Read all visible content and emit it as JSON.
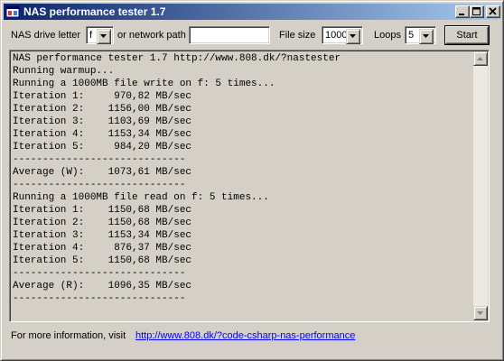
{
  "window": {
    "title": "NAS performance tester 1.7",
    "icon": "app-window-icon"
  },
  "toolbar": {
    "drive_label": "NAS drive letter",
    "drive_value": "f",
    "network_label": "or network path",
    "network_value": "",
    "filesize_label": "File size",
    "filesize_value": "1000",
    "loops_label": "Loops",
    "loops_value": "5",
    "start_label": "Start"
  },
  "output": {
    "lines": [
      "NAS performance tester 1.7 http://www.808.dk/?nastester",
      "Running warmup...",
      "Running a 1000MB file write on f: 5 times...",
      "Iteration 1:     970,82 MB/sec",
      "Iteration 2:    1156,00 MB/sec",
      "Iteration 3:    1103,69 MB/sec",
      "Iteration 4:    1153,34 MB/sec",
      "Iteration 5:     984,20 MB/sec",
      "-----------------------------",
      "Average (W):    1073,61 MB/sec",
      "-----------------------------",
      "Running a 1000MB file read on f: 5 times...",
      "Iteration 1:    1150,68 MB/sec",
      "Iteration 2:    1150,68 MB/sec",
      "Iteration 3:    1153,34 MB/sec",
      "Iteration 4:     876,37 MB/sec",
      "Iteration 5:    1150,68 MB/sec",
      "-----------------------------",
      "Average (R):    1096,35 MB/sec",
      "-----------------------------"
    ]
  },
  "footer": {
    "info_label": "For more information, visit",
    "link_text": "http://www.808.dk/?code-csharp-nas-performance"
  }
}
